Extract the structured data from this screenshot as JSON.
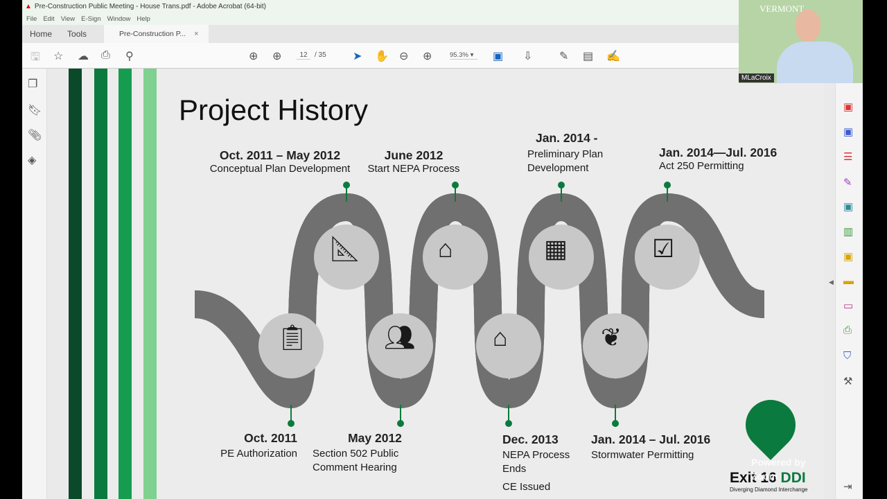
{
  "window": {
    "title": "Pre-Construction Public Meeting - House Trans.pdf - Adobe Acrobat (64-bit)"
  },
  "menu": [
    "File",
    "Edit",
    "View",
    "E-Sign",
    "Window",
    "Help"
  ],
  "tabs": {
    "home": "Home",
    "tools": "Tools",
    "document": "Pre-Construction P...",
    "close": "×"
  },
  "toolbar": {
    "page_current": "12",
    "page_total": "/ 35",
    "zoom": "95.3%"
  },
  "slide": {
    "title": "Project History",
    "top_milestones": [
      {
        "date": "Oct. 2011 – May 2012",
        "desc": "Conceptual Plan Development",
        "icon": "blueprint-pencil-icon"
      },
      {
        "date": "June 2012",
        "desc": "Start NEPA Process",
        "icon": "house-plan-icon"
      },
      {
        "date": "Jan. 2014 -",
        "desc": "Preliminary Plan Development",
        "icon": "topographic-map-icon"
      },
      {
        "date": "Jan. 2014—Jul. 2016",
        "desc": "Act 250 Permitting",
        "icon": "checklist-icon"
      }
    ],
    "bottom_milestones": [
      {
        "date": "Oct. 2011",
        "desc": "PE Authorization",
        "icon": "certificate-clipboard-icon"
      },
      {
        "date": "May 2012",
        "desc": "Section 502 Public Comment Hearing",
        "icon": "meeting-icon"
      },
      {
        "date": "Dec. 2013",
        "desc": "NEPA Process Ends",
        "extra": "CE Issued",
        "icon": "house-plan-icon"
      },
      {
        "date": "Jan. 2014 – Jul. 2016",
        "desc": "Stormwater Permitting",
        "icon": "water-splash-icon"
      }
    ],
    "logo_title_a": "Exit 16 ",
    "logo_title_b": "DDI",
    "logo_subtitle": "Diverging Diamond Interchange"
  },
  "video": {
    "name": "MLaCroix",
    "watermark": "Powered by Zoom",
    "org": "VERMONT"
  },
  "colors": {
    "green": "#0b7a3e",
    "dark_green": "#0a4a2a",
    "light_green": "#7fd18f",
    "road_edge": "#6e6e6e"
  }
}
